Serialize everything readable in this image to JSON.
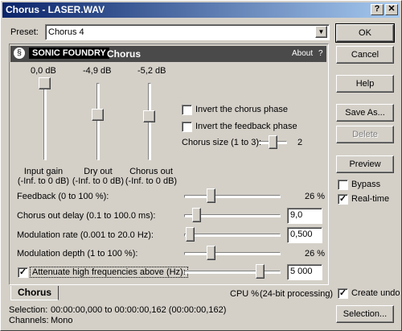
{
  "window": {
    "title": "Chorus - LASER.WAV",
    "help_button": "?",
    "close_button": "✕"
  },
  "preset": {
    "label": "Preset:",
    "value": "Chorus 4"
  },
  "banner": {
    "brand": "SONIC FOUNDRY",
    "plugin_name": "Chorus",
    "about": "About",
    "help": "?"
  },
  "sliders_vertical": [
    {
      "value": "0,0 dB",
      "label1": "Input gain",
      "label2": "(-Inf. to 0 dB)",
      "level": 1.0
    },
    {
      "value": "-4,9 dB",
      "label1": "Dry out",
      "label2": "(-Inf. to 0 dB)",
      "level": 0.57
    },
    {
      "value": "-5,2 dB",
      "label1": "Chorus out",
      "label2": "(-Inf. to 0 dB)",
      "level": 0.55
    }
  ],
  "options": {
    "invert_chorus": {
      "label": "Invert the chorus phase",
      "checked": false
    },
    "invert_feedback": {
      "label": "Invert the feedback phase",
      "checked": false
    },
    "chorus_size": {
      "label": "Chorus size (1 to 3):",
      "value": "2",
      "level": 0.5
    }
  },
  "params": [
    {
      "label": "Feedback (0 to 100 %):",
      "value": "26 %",
      "level": 0.26,
      "type": "text"
    },
    {
      "label": "Chorus out delay (0.1 to 100.0 ms):",
      "value": "9,0",
      "level": 0.09,
      "type": "field"
    },
    {
      "label": "Modulation rate (0.001 to 20.0 Hz):",
      "value": "0,500",
      "level": 0.02,
      "type": "field"
    },
    {
      "label": "Modulation depth (1 to 100 %):",
      "value": "26 %",
      "level": 0.26,
      "type": "text"
    },
    {
      "label": "Attenuate high frequencies above (Hz):",
      "value": "5 000",
      "level": 0.82,
      "type": "field",
      "checked": true
    }
  ],
  "tab": {
    "label": "Chorus"
  },
  "status": {
    "cpu": "CPU %",
    "processing": "(24-bit processing)"
  },
  "footer": {
    "selection_label": "Selection:",
    "selection_value": "00:00:00,000 to 00:00:00,162 (00:00:00,162)",
    "channels_label": "Channels:",
    "channels_value": "Mono"
  },
  "buttons": {
    "ok": "OK",
    "cancel": "Cancel",
    "help": "Help",
    "save_as": "Save As...",
    "delete": "Delete",
    "preview": "Preview",
    "selection": "Selection..."
  },
  "side_options": {
    "bypass": {
      "label": "Bypass",
      "checked": false
    },
    "realtime": {
      "label": "Real-time",
      "checked": true
    },
    "create_undo": {
      "label": "Create undo",
      "checked": true
    }
  },
  "colors": {
    "title_start": "#0a246a",
    "title_end": "#a6caf0",
    "face": "#d4d0c8",
    "banner": "#4a4a4a"
  }
}
